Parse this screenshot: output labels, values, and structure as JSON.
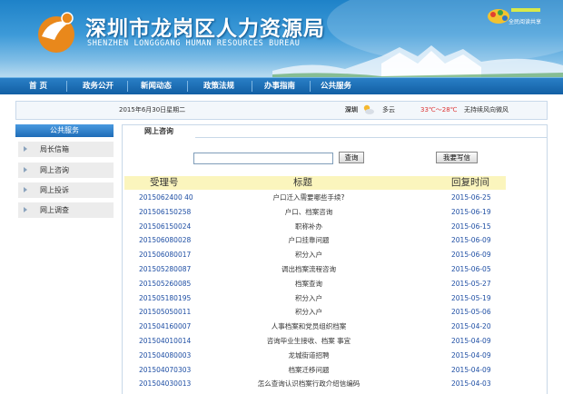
{
  "header": {
    "title_cn": "深圳市龙岗区人力资源局",
    "title_en": "SHENZHEN LONGGGANG HUMAN RESOURCES BUREAU",
    "badge": "全民阅读共享"
  },
  "nav": [
    "首 页",
    "政务公开",
    "新闻动态",
    "政策法规",
    "办事指南",
    "公共服务"
  ],
  "info": {
    "date": "2015年6月30日星期二",
    "city": "深圳",
    "condition": "多云",
    "temp": "33℃～28℃",
    "wind": "无持续风向微风"
  },
  "sidebar": {
    "title": "公共服务",
    "items": [
      "局长信箱",
      "网上咨询",
      "网上投诉",
      "网上调查"
    ]
  },
  "main": {
    "tab": "网上咨询",
    "search_placeholder": "",
    "search_button": "查询",
    "write_button": "我要写信",
    "columns": [
      "受理号",
      "标题",
      "回复时间"
    ],
    "rows": [
      {
        "id": "2015062400 40",
        "title": "户口迁入需要哪些手续?",
        "date": "2015-06-25"
      },
      {
        "id": "201506150258",
        "title": "户口、档案咨询",
        "date": "2015-06-19"
      },
      {
        "id": "201506150024",
        "title": "职称补办",
        "date": "2015-06-15"
      },
      {
        "id": "201506080028",
        "title": "户口挂靠问题",
        "date": "2015-06-09"
      },
      {
        "id": "201506080017",
        "title": "积分入户",
        "date": "2015-06-09"
      },
      {
        "id": "201505280087",
        "title": "调出档案流程咨询",
        "date": "2015-06-05"
      },
      {
        "id": "201505260085",
        "title": "档案查询",
        "date": "2015-05-27"
      },
      {
        "id": "201505180195",
        "title": "积分入户",
        "date": "2015-05-19"
      },
      {
        "id": "201505050011",
        "title": "积分入户",
        "date": "2015-05-06"
      },
      {
        "id": "201504160007",
        "title": "人事档案和党员组织档案",
        "date": "2015-04-20"
      },
      {
        "id": "201504010014",
        "title": "咨询毕业生接收、档案 事宜",
        "date": "2015-04-09"
      },
      {
        "id": "201504080003",
        "title": "龙城街道招聘",
        "date": "2015-04-09"
      },
      {
        "id": "201504070303",
        "title": "档案迁移问题",
        "date": "2015-04-09"
      },
      {
        "id": "201504030013",
        "title": "怎么查询认识档案行政介绍信编码",
        "date": "2015-04-03"
      }
    ]
  },
  "colors": {
    "nav_bg": "#1a6cb5",
    "link": "#1f4fa4",
    "table_header": "#fbf5bd"
  }
}
